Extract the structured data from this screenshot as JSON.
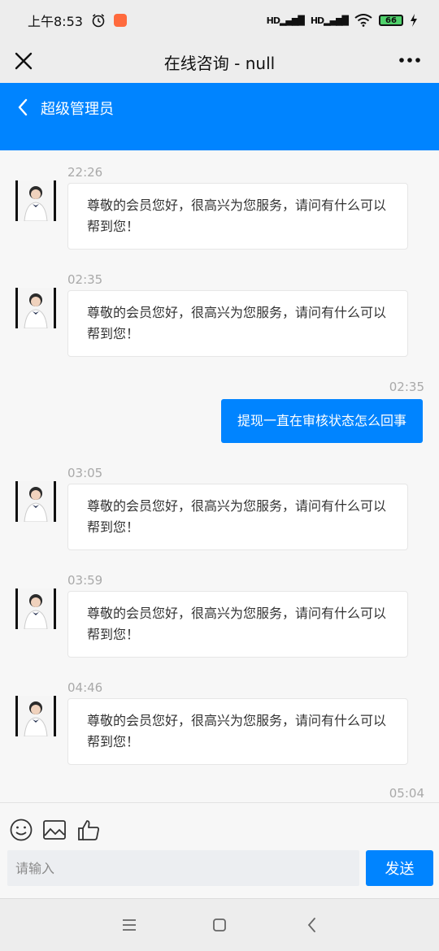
{
  "status_bar": {
    "time": "上午8:53",
    "signal1": "HD",
    "signal2": "HD",
    "battery": "66"
  },
  "title_bar": {
    "title": "在线咨询 - null"
  },
  "chat_header": {
    "back": "‹",
    "name": "超级管理员"
  },
  "messages": [
    {
      "type": "in",
      "time": "22:26",
      "text": "尊敬的会员您好，很高兴为您服务，请问有什么可以帮到您！"
    },
    {
      "type": "in",
      "time": "02:35",
      "text": "尊敬的会员您好，很高兴为您服务，请问有什么可以帮到您！"
    },
    {
      "type": "out",
      "time": "02:35",
      "text": "提现一直在审核状态怎么回事"
    },
    {
      "type": "in",
      "time": "03:05",
      "text": "尊敬的会员您好，很高兴为您服务，请问有什么可以帮到您！"
    },
    {
      "type": "in",
      "time": "03:59",
      "text": "尊敬的会员您好，很高兴为您服务，请问有什么可以帮到您！"
    },
    {
      "type": "in",
      "time": "04:46",
      "text": "尊敬的会员您好，很高兴为您服务，请问有什么可以帮到您！"
    },
    {
      "type": "out",
      "time": "05:04",
      "text": ""
    }
  ],
  "input": {
    "placeholder": "请输入",
    "send_label": "发送"
  },
  "toolbar": {
    "icons": [
      "emoji-icon",
      "image-icon",
      "thumbs-up-icon"
    ]
  },
  "nav_bar": {
    "icons": [
      "menu-icon",
      "home-icon",
      "back-icon"
    ]
  },
  "colors": {
    "accent": "#0084ff",
    "background": "#f7f7f7",
    "bubble_in": "#ffffff"
  }
}
